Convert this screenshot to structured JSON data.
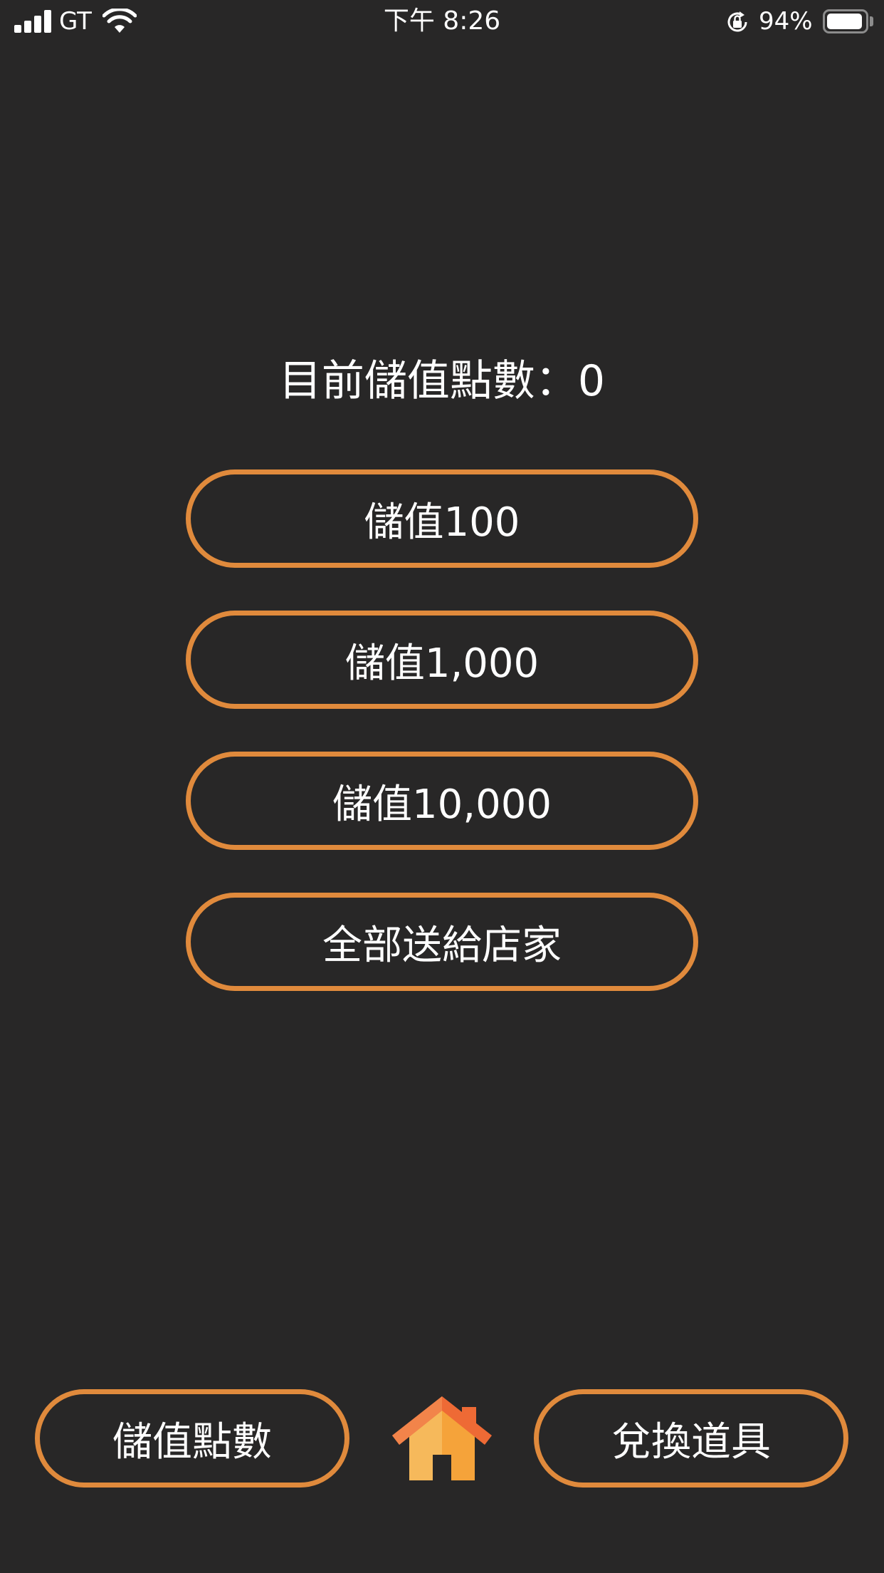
{
  "status_bar": {
    "carrier": "GT",
    "time": "下午 8:26",
    "battery_percent_text": "94%",
    "battery_level": 0.94,
    "signal_bars": 4,
    "icons": [
      "signal-icon",
      "wifi-icon",
      "rotation-lock-icon",
      "battery-icon"
    ]
  },
  "points": {
    "label": "目前儲值點數：0"
  },
  "actions": {
    "topup_100": "儲值100",
    "topup_1000": "儲值1,000",
    "topup_10000": "儲值10,000",
    "give_all": "全部送給店家"
  },
  "bottom_nav": {
    "store_points": "儲值點數",
    "home_icon": "home-icon",
    "redeem_items": "兌換道具"
  },
  "colors": {
    "background": "#282727",
    "accent": "#e08a3c",
    "text": "#ffffff",
    "home_roof": "#ee6a35",
    "home_body": "#f5a33a"
  }
}
